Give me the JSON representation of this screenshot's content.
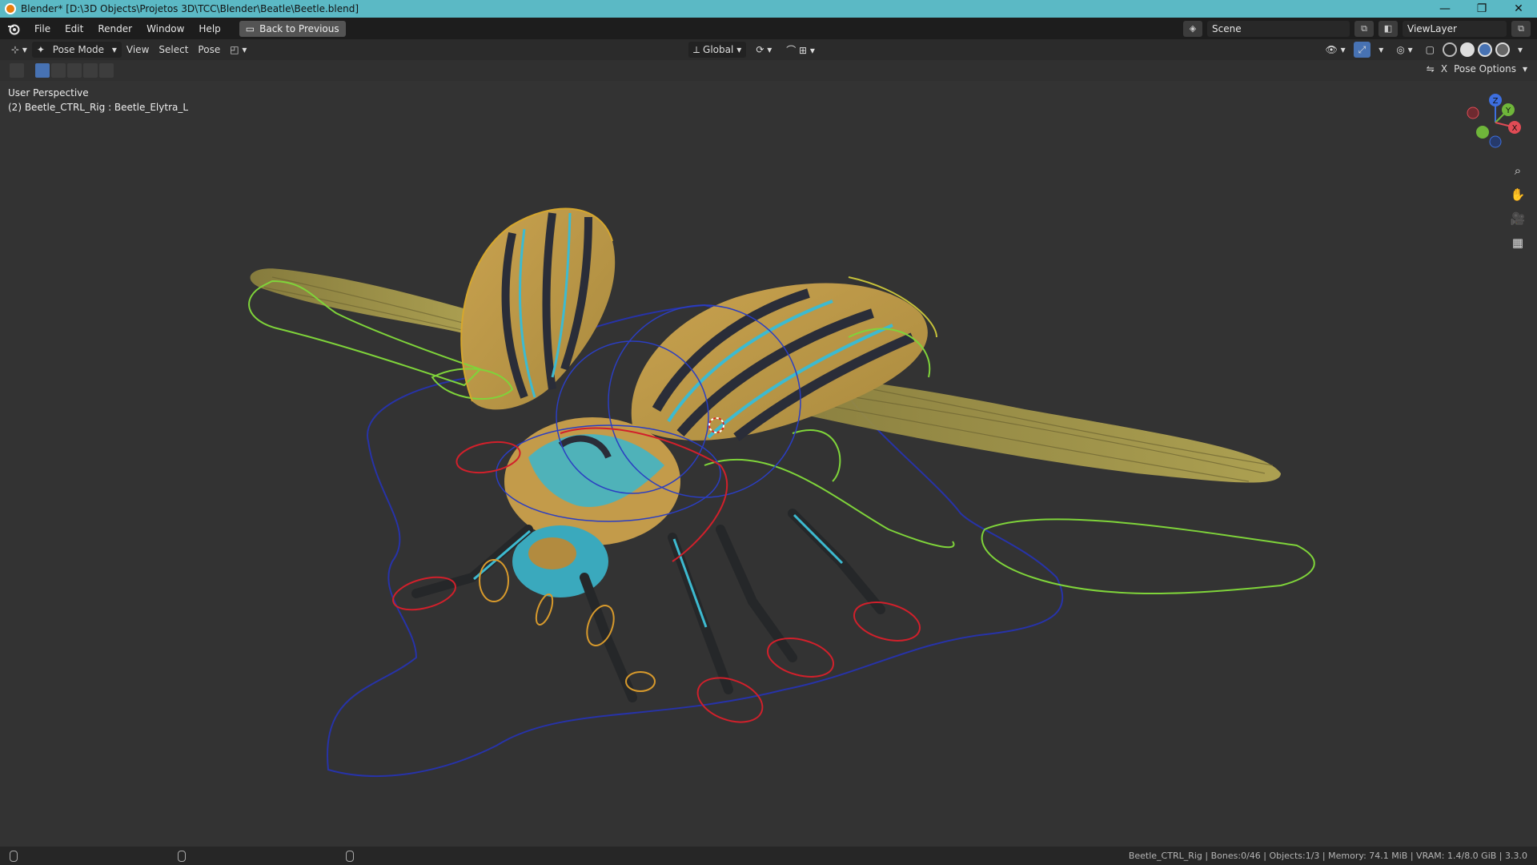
{
  "window": {
    "title": "Blender* [D:\\3D Objects\\Projetos 3D\\TCC\\Blender\\Beatle\\Beetle.blend]",
    "minimize": "—",
    "restore": "❐",
    "close": "✕"
  },
  "menu": {
    "items": [
      "File",
      "Edit",
      "Render",
      "Window",
      "Help"
    ],
    "back_button": "Back to Previous"
  },
  "topright": {
    "scene": "Scene",
    "view_layer": "ViewLayer"
  },
  "header": {
    "mode": "Pose Mode",
    "menus": [
      "View",
      "Select",
      "Pose"
    ],
    "orientation": "Global"
  },
  "toolrow": {
    "pose_options": "Pose Options"
  },
  "viewport": {
    "perspective": "User Perspective",
    "active": "(2) Beetle_CTRL_Rig : Beetle_Elytra_L",
    "gizmo_axes": [
      "Z",
      "Y",
      "X"
    ]
  },
  "status": {
    "stats": "Beetle_CTRL_Rig | Bones:0/46 | Objects:1/3 | Memory: 74.1 MiB | VRAM: 1.4/8.0 GiB | 3.3.0"
  },
  "colors": {
    "title_bar": "#5bb9c5",
    "viewport_bg": "#333333",
    "accent": "#4772b3"
  }
}
